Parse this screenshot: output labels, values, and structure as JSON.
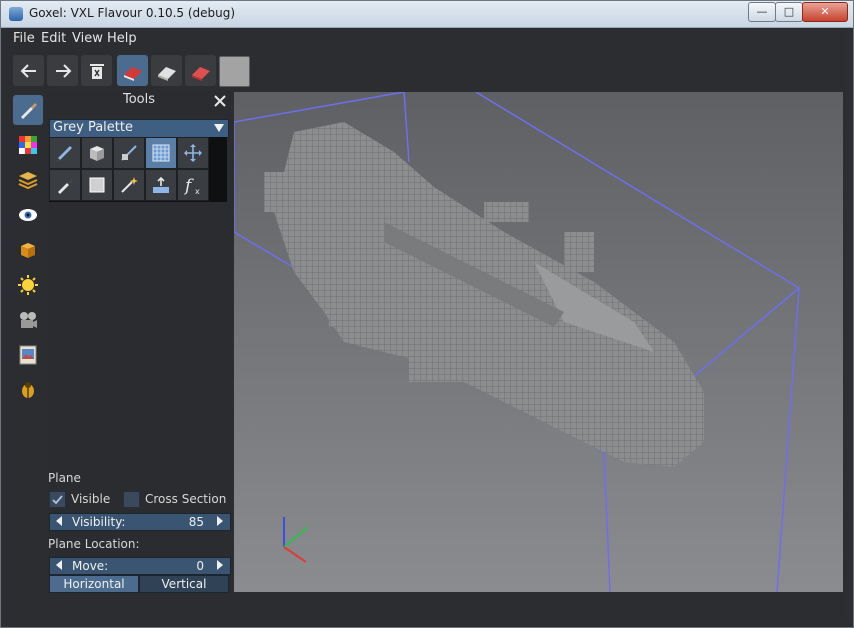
{
  "window": {
    "title": "Goxel: VXL Flavour 0.10.5 (debug)"
  },
  "menu": {
    "items": [
      "File",
      "Edit",
      "View",
      "Help"
    ]
  },
  "toolbar": {
    "buttons": [
      "undo-arrow-icon",
      "redo-arrow-icon",
      "trash-icon",
      "eraser-red-icon",
      "eraser-white-icon",
      "eraser-red-flat-icon"
    ],
    "color_swatch": "#a3a3a3"
  },
  "sidebar": {
    "items": [
      "brush-icon",
      "palette-icon",
      "layers-icon",
      "eye-icon",
      "cube-icon",
      "sun-icon",
      "camera-icon",
      "image-icon",
      "bug-icon"
    ]
  },
  "panel": {
    "title": "Tools",
    "palette_name": "Grey Palette",
    "tools_row1": [
      "pencil-icon",
      "cube-tool-icon",
      "line-tool-icon",
      "selection-grid-icon",
      "move-icon"
    ],
    "tools_row2": [
      "color-picker-icon",
      "rect-selection-icon",
      "magic-wand-icon",
      "extrude-icon",
      "procedural-fx-icon"
    ]
  },
  "plane": {
    "heading": "Plane",
    "visible_label": "Visible",
    "cross_section_label": "Cross Section",
    "visibility_label": "Visibility:",
    "visibility_value": "85",
    "location_heading": "Plane Location:",
    "move_label": "Move:",
    "move_value": "0",
    "horizontal_label": "Horizontal",
    "vertical_label": "Vertical"
  },
  "colors": {
    "accent": "#4b6c8f",
    "bounding_box": "#6e6ef0",
    "voxel": "#8c8d8f"
  }
}
